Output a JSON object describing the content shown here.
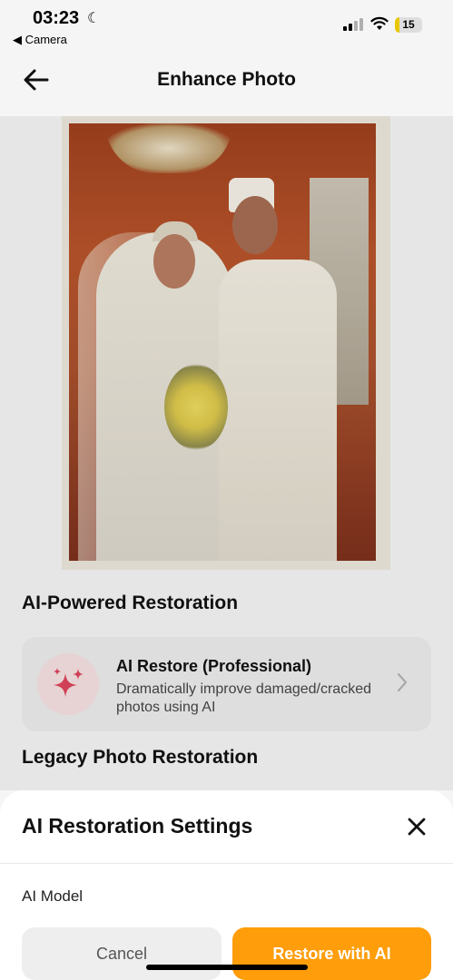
{
  "status_bar": {
    "time": "03:23",
    "back_app": "◀ Camera",
    "battery_level": "15",
    "battery_fraction": 0.15
  },
  "nav": {
    "title": "Enhance Photo"
  },
  "sections": {
    "ai_powered_title": "AI-Powered Restoration",
    "legacy_title": "Legacy Photo Restoration"
  },
  "ai_restore_card": {
    "title": "AI Restore (Professional)",
    "description": "Dramatically improve damaged/cracked photos using AI",
    "icon": "sparkles-icon"
  },
  "sheet": {
    "title": "AI Restoration Settings",
    "model_label": "AI Model",
    "cancel_label": "Cancel",
    "restore_label": "Restore with AI"
  },
  "colors": {
    "accent": "#ff9d0a",
    "icon_tint": "#d9435a",
    "icon_bg": "#f1dcdc"
  }
}
